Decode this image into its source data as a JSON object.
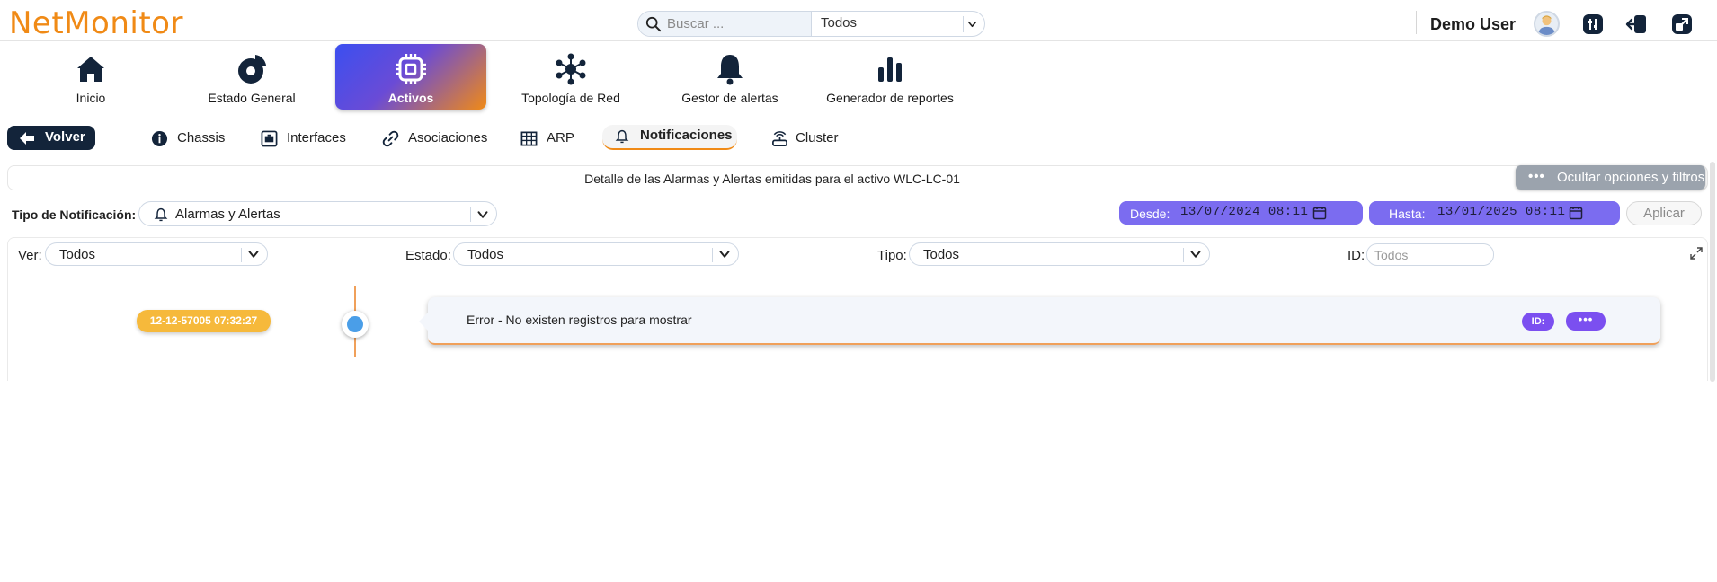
{
  "app": {
    "logo": "NetMonitor"
  },
  "search": {
    "placeholder": "Buscar ...",
    "value": "",
    "scope": "Todos"
  },
  "user": {
    "name": "Demo User"
  },
  "nav": [
    {
      "label": "Inicio",
      "icon": "home-icon"
    },
    {
      "label": "Estado General",
      "icon": "pie-chart-icon"
    },
    {
      "label": "Activos",
      "icon": "chip-icon",
      "active": true
    },
    {
      "label": "Topología de Red",
      "icon": "network-icon"
    },
    {
      "label": "Gestor de alertas",
      "icon": "bell-icon"
    },
    {
      "label": "Generador de reportes",
      "icon": "bar-chart-icon"
    }
  ],
  "subnav": {
    "back": "Volver",
    "tabs": [
      {
        "label": "Chassis",
        "icon": "info-icon"
      },
      {
        "label": "Interfaces",
        "icon": "port-icon"
      },
      {
        "label": "Asociaciones",
        "icon": "link-icon"
      },
      {
        "label": "ARP",
        "icon": "table-icon"
      },
      {
        "label": "Notificaciones",
        "icon": "bell-icon",
        "active": true
      },
      {
        "label": "Cluster",
        "icon": "router-icon"
      }
    ]
  },
  "detail": {
    "title": "Detalle de las Alarmas y Alertas emitidas para el activo WLC-LC-01",
    "hide_options": "Ocultar opciones y filtros"
  },
  "notif_type": {
    "label": "Tipo de Notificación:",
    "value": "Alarmas y Alertas"
  },
  "dates": {
    "from_label": "Desde:",
    "from_value": "13/07/2024 08:11",
    "to_label": "Hasta:",
    "to_value": "13/01/2025 08:11",
    "apply": "Aplicar"
  },
  "filters": {
    "ver_label": "Ver:",
    "ver_value": "Todos",
    "estado_label": "Estado:",
    "estado_value": "Todos",
    "tipo_label": "Tipo:",
    "tipo_value": "Todos",
    "id_label": "ID:",
    "id_placeholder": "Todos"
  },
  "timeline": {
    "date": "12-12-57005 07:32:27",
    "message": "Error - No existen registros para mostrar",
    "id_badge": "ID:",
    "more": "•••"
  },
  "colors": {
    "brand_orange": "#f08a16",
    "accent_purple": "#7b6cf0",
    "dark_navy": "#13243a"
  }
}
